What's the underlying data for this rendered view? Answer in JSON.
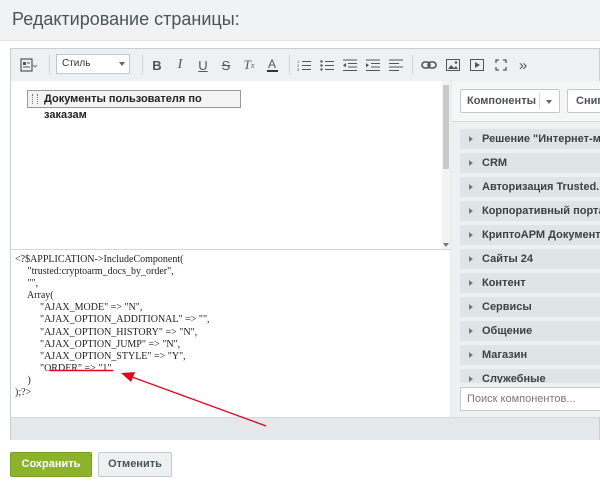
{
  "header": {
    "title": "Редактирование страницы:"
  },
  "toolbar": {
    "style_select": "Стиль",
    "icons": [
      "source-icon",
      "bold-icon",
      "italic-icon",
      "underline-icon",
      "strikethrough-icon",
      "remove-format-icon",
      "text-color-icon",
      "ordered-list-icon",
      "unordered-list-icon",
      "outdent-icon",
      "indent-icon",
      "align-icon",
      "link-icon",
      "image-icon",
      "video-icon",
      "fullscreen-icon",
      "more-icon"
    ]
  },
  "editor": {
    "component_label": "Документы пользователя по заказам"
  },
  "code_lines": [
    "<?$APPLICATION->IncludeComponent(",
    "     \"trusted:cryptoarm_docs_by_order\",",
    "     \"\",",
    "     Array(",
    "          \"AJAX_MODE\" => \"N\",",
    "          \"AJAX_OPTION_ADDITIONAL\" => \"\",",
    "          \"AJAX_OPTION_HISTORY\" => \"N\",",
    "          \"AJAX_OPTION_JUMP\" => \"N\",",
    "          \"AJAX_OPTION_STYLE\" => \"Y\",",
    "          \"ORDER\" => \"1\"",
    "     )",
    ");?>"
  ],
  "sidebar": {
    "components_button": "Компоненты",
    "snippets_button": "Снип",
    "categories": [
      "Решение \"Интернет-магаз",
      "CRM",
      "Авторизация Trusted.Id",
      "Корпоративный портал",
      "КриптоАРМ Документы",
      "Сайты 24",
      "Контент",
      "Сервисы",
      "Общение",
      "Магазин",
      "Служебные"
    ],
    "search_placeholder": "Поиск компонентов..."
  },
  "footer": {
    "save": "Сохранить",
    "cancel": "Отменить"
  },
  "colors": {
    "save_bg": "#8bb32b",
    "annotation": "#e8001c"
  }
}
